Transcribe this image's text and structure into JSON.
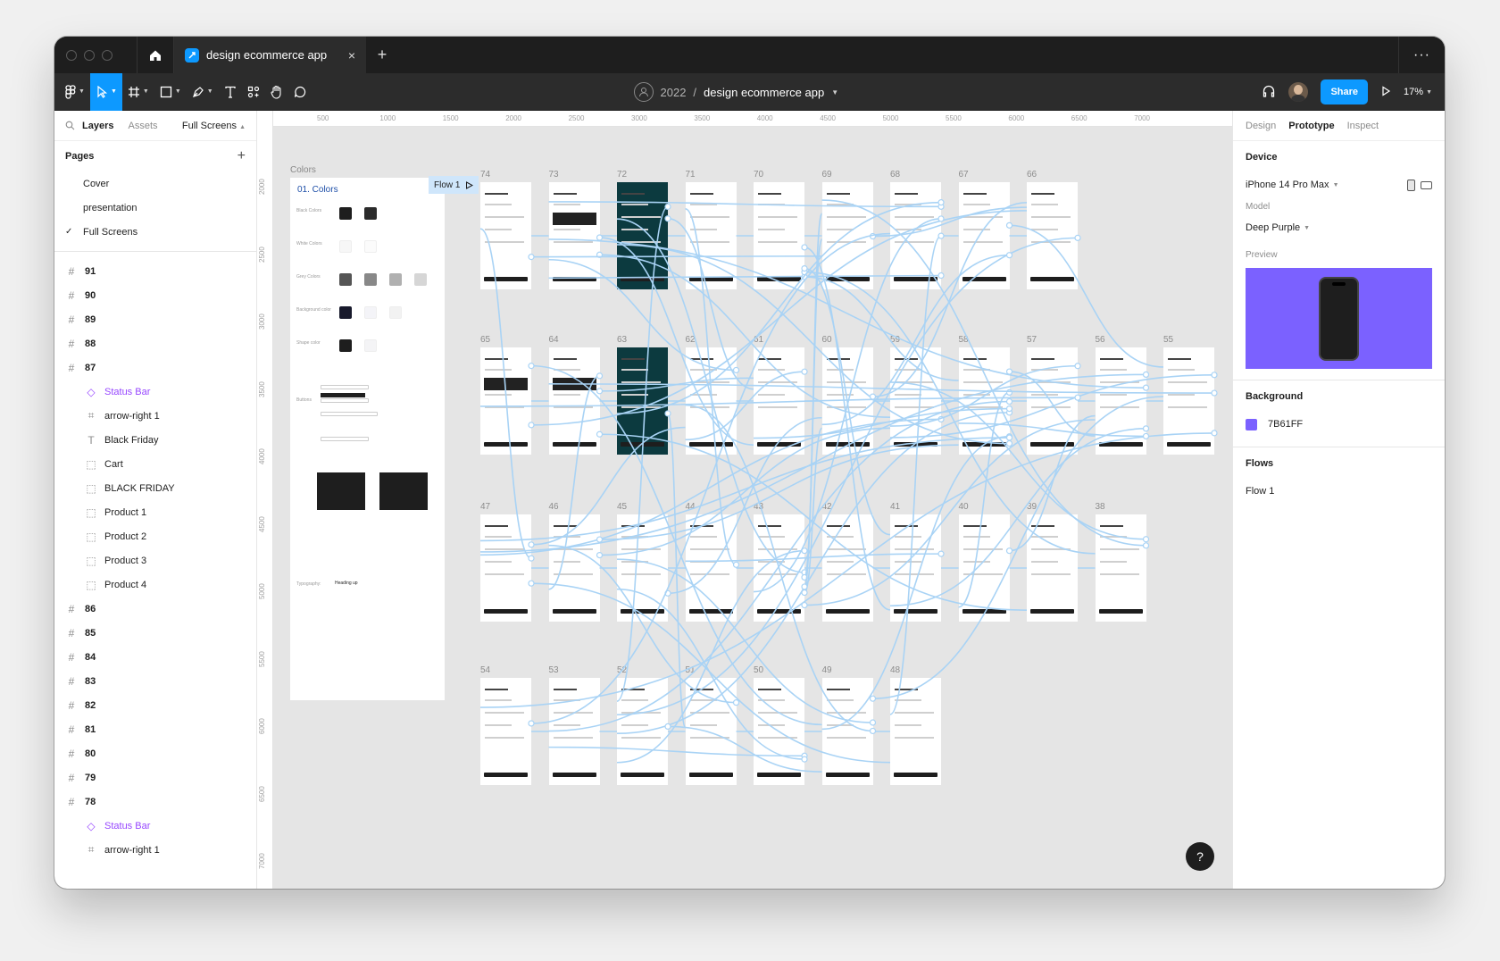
{
  "titlebar": {
    "tab_title": "design ecommerce app",
    "tab_close": "×",
    "new_tab": "+",
    "more": "···"
  },
  "toolbar": {
    "team": "2022",
    "separator": "/",
    "file_name": "design ecommerce app",
    "share_label": "Share",
    "zoom": "17%"
  },
  "left_panel": {
    "tabs": [
      "Layers",
      "Assets"
    ],
    "page_picker": "Full Screens",
    "pages_title": "Pages",
    "add_page": "+",
    "pages": [
      {
        "label": "Cover",
        "checked": false
      },
      {
        "label": "presentation",
        "checked": false
      },
      {
        "label": "Full Screens",
        "checked": true
      }
    ],
    "layers": [
      {
        "label": "91",
        "kind": "frame"
      },
      {
        "label": "90",
        "kind": "frame"
      },
      {
        "label": "89",
        "kind": "frame"
      },
      {
        "label": "88",
        "kind": "frame"
      },
      {
        "label": "87",
        "kind": "frame"
      },
      {
        "label": "Status Bar",
        "kind": "component"
      },
      {
        "label": "arrow-right 1",
        "kind": "child"
      },
      {
        "label": "Black Friday",
        "kind": "text"
      },
      {
        "label": "Cart",
        "kind": "group"
      },
      {
        "label": "BLACK FRIDAY",
        "kind": "group"
      },
      {
        "label": "Product 1",
        "kind": "group"
      },
      {
        "label": "Product 2",
        "kind": "group"
      },
      {
        "label": "Product 3",
        "kind": "group"
      },
      {
        "label": "Product 4",
        "kind": "group"
      },
      {
        "label": "86",
        "kind": "frame"
      },
      {
        "label": "85",
        "kind": "frame"
      },
      {
        "label": "84",
        "kind": "frame"
      },
      {
        "label": "83",
        "kind": "frame"
      },
      {
        "label": "82",
        "kind": "frame"
      },
      {
        "label": "81",
        "kind": "frame"
      },
      {
        "label": "80",
        "kind": "frame"
      },
      {
        "label": "79",
        "kind": "frame"
      },
      {
        "label": "78",
        "kind": "frame"
      },
      {
        "label": "Status Bar",
        "kind": "component"
      },
      {
        "label": "arrow-right 1",
        "kind": "child"
      }
    ]
  },
  "canvas": {
    "ruler_top": [
      "500",
      "1000",
      "1500",
      "2000",
      "2500",
      "3000",
      "3500",
      "4000",
      "4500",
      "5000",
      "5500",
      "6000",
      "6500",
      "7000"
    ],
    "ruler_left": [
      "2000",
      "2500",
      "3000",
      "3500",
      "4000",
      "4500",
      "5000",
      "5500",
      "6000",
      "6500",
      "7000"
    ],
    "style_board_title": "Colors",
    "style_board_heading": "01. Colors",
    "style_labels": [
      "Black Colors",
      "White Colors",
      "Grey Colors",
      "Background color",
      "Shape color",
      "Buttons",
      "Typography:"
    ],
    "typography_heading": "Heading up",
    "flow_tag": "Flow 1",
    "frame_rows": [
      [
        "74",
        "73",
        "72",
        "71",
        "70",
        "69",
        "68",
        "67",
        "66"
      ],
      [
        "65",
        "64",
        "63",
        "62",
        "61",
        "60",
        "59",
        "58",
        "57",
        "56",
        "55"
      ],
      [
        "47",
        "46",
        "45",
        "44",
        "43",
        "42",
        "41",
        "40",
        "39",
        "38"
      ],
      [
        "54",
        "53",
        "52",
        "51",
        "50",
        "49",
        "48"
      ]
    ],
    "help": "?"
  },
  "right_panel": {
    "tabs": [
      "Design",
      "Prototype",
      "Inspect"
    ],
    "active_tab": "Prototype",
    "device_heading": "Device",
    "device": "iPhone 14 Pro Max",
    "model_label": "Model",
    "model": "Deep Purple",
    "preview_label": "Preview",
    "preview_color": "#7B61FF",
    "background_heading": "Background",
    "background_value": "7B61FF",
    "background_color": "#7B61FF",
    "flows_heading": "Flows",
    "flow_item": "Flow 1"
  },
  "colors": {
    "accent": "#0d99ff",
    "component": "#9747ff",
    "flow_line": "#a9d3f5"
  }
}
